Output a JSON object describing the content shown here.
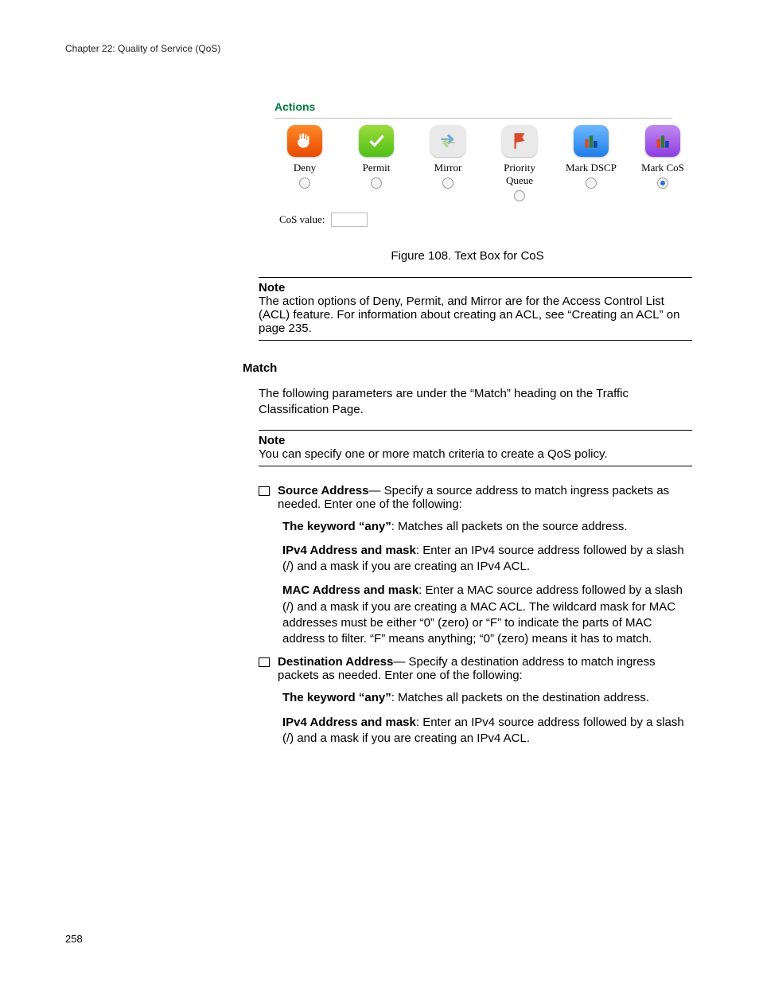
{
  "header": "Chapter 22: Quality of Service (QoS)",
  "page_number": "258",
  "figure": {
    "panel_title": "Actions",
    "caption": "Figure 108. Text Box for CoS",
    "cos_label": "CoS value:",
    "cos_value": "",
    "items": [
      {
        "label": "Deny",
        "selected": false
      },
      {
        "label": "Permit",
        "selected": false
      },
      {
        "label": "Mirror",
        "selected": false
      },
      {
        "label": "Priority Queue",
        "selected": false
      },
      {
        "label": "Mark DSCP",
        "selected": false
      },
      {
        "label": "Mark CoS",
        "selected": true
      }
    ]
  },
  "note1": {
    "title": "Note",
    "body": "The action options of Deny, Permit, and Mirror are for the Access Control List (ACL) feature. For information about creating an ACL, see “Creating an ACL” on page 235."
  },
  "section_match_title": "Match",
  "match_intro": "The following parameters are under the “Match” heading on the Traffic Classification Page.",
  "note2": {
    "title": "Note",
    "body": "You can specify one or more match criteria to create a QoS policy."
  },
  "src": {
    "heading": "Source Address",
    "tail": "— Specify a source address to match ingress packets as needed. Enter one of the following:",
    "any_h": "The keyword “any”",
    "any_t": ": Matches all packets on the source address.",
    "ipv4_h": "IPv4 Address and mask",
    "ipv4_t": ": Enter an IPv4 source address followed by a slash (/) and a mask if you are creating an IPv4 ACL.",
    "mac_h": "MAC Address and mask",
    "mac_t": ": Enter a MAC source address followed by a slash (/) and a mask if you are creating a MAC ACL. The wildcard mask for MAC addresses must be either “0” (zero) or “F” to indicate the parts of MAC address to filter. “F” means anything; “0” (zero) means it has to match."
  },
  "dst": {
    "heading": "Destination Address",
    "tail": "— Specify a destination address to match ingress packets as needed. Enter one of the following:",
    "any_h": "The keyword “any”",
    "any_t": ": Matches all packets on the destination address.",
    "ipv4_h": "IPv4 Address and mask",
    "ipv4_t": ": Enter an IPv4 source address followed by a slash (/) and a mask if you are creating an IPv4 ACL."
  }
}
